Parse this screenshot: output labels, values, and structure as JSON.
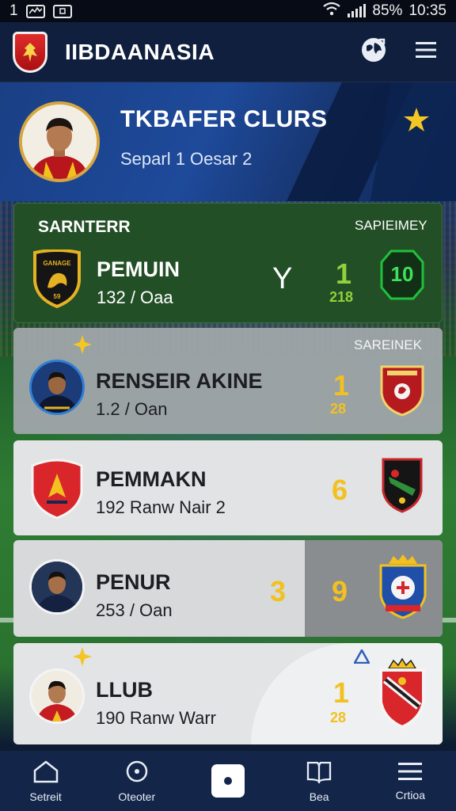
{
  "status_bar": {
    "left_label": "1",
    "battery": "85%",
    "time": "10:35"
  },
  "app_bar": {
    "title": "IIBDAANASIA",
    "icons": [
      "club-shield-logo",
      "globe-icon",
      "menu-icon"
    ]
  },
  "hero": {
    "title": "TKBAFER CLURS",
    "subtitle": "Separl 1 Oesar 2"
  },
  "cards": [
    {
      "tag_left": "SARNTERR",
      "tag_right": "SAPIEIMEY",
      "title": "PEMUIN",
      "subtitle": "132 / Oaa",
      "middle": "Y",
      "score": "1",
      "score_sub": "218",
      "badge": "10",
      "crest_text": "GANAGE",
      "crest_num": "59"
    },
    {
      "tag_right": "SAREINEK",
      "title": "RENSEIR AKINE",
      "subtitle": "1.2 / Oan",
      "score": "1",
      "score_sub": "28"
    },
    {
      "title": "PEMMAKN",
      "subtitle": "192 Ranw Nair 2",
      "score": "6"
    },
    {
      "title": "PENUR",
      "subtitle": "253 / Oan",
      "score": "3",
      "score2": "9"
    },
    {
      "title": "LLUB",
      "subtitle": "190 Ranw Warr",
      "score": "1",
      "score_sub": "28"
    }
  ],
  "bottom_nav": [
    {
      "label": "Setreit",
      "icon": "home-icon"
    },
    {
      "label": "Oteoter",
      "icon": "compass-icon"
    },
    {
      "label": "",
      "icon": "center-dot-icon"
    },
    {
      "label": "Bea",
      "icon": "book-icon"
    },
    {
      "label": "Crtioa",
      "icon": "menu-icon"
    }
  ],
  "colors": {
    "app_bar": "#0f1f3d",
    "hero": "#1e4a9a",
    "featured_card": "#234f26",
    "score_gold": "#f2c11f",
    "bottom_nav": "#13264a"
  }
}
